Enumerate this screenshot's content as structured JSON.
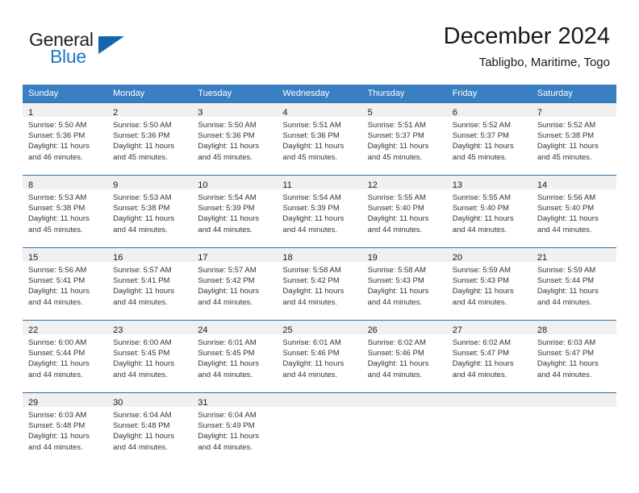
{
  "brand": {
    "word_general": "General",
    "word_blue": "Blue",
    "accent_color": "#1267ae",
    "text_color": "#231f20"
  },
  "header": {
    "title": "December 2024",
    "subtitle": "Tabligbo, Maritime, Togo"
  },
  "theme": {
    "header_row_bg": "#3a7fc1",
    "daynum_band_bg": "#f0f0f0",
    "row_divider": "#2f6fae",
    "body_text": "#333333"
  },
  "weekday_headers": [
    "Sunday",
    "Monday",
    "Tuesday",
    "Wednesday",
    "Thursday",
    "Friday",
    "Saturday"
  ],
  "weeks": [
    [
      {
        "day": "1",
        "sunrise": "Sunrise: 5:50 AM",
        "sunset": "Sunset: 5:36 PM",
        "daylight_1": "Daylight: 11 hours",
        "daylight_2": "and 46 minutes."
      },
      {
        "day": "2",
        "sunrise": "Sunrise: 5:50 AM",
        "sunset": "Sunset: 5:36 PM",
        "daylight_1": "Daylight: 11 hours",
        "daylight_2": "and 45 minutes."
      },
      {
        "day": "3",
        "sunrise": "Sunrise: 5:50 AM",
        "sunset": "Sunset: 5:36 PM",
        "daylight_1": "Daylight: 11 hours",
        "daylight_2": "and 45 minutes."
      },
      {
        "day": "4",
        "sunrise": "Sunrise: 5:51 AM",
        "sunset": "Sunset: 5:36 PM",
        "daylight_1": "Daylight: 11 hours",
        "daylight_2": "and 45 minutes."
      },
      {
        "day": "5",
        "sunrise": "Sunrise: 5:51 AM",
        "sunset": "Sunset: 5:37 PM",
        "daylight_1": "Daylight: 11 hours",
        "daylight_2": "and 45 minutes."
      },
      {
        "day": "6",
        "sunrise": "Sunrise: 5:52 AM",
        "sunset": "Sunset: 5:37 PM",
        "daylight_1": "Daylight: 11 hours",
        "daylight_2": "and 45 minutes."
      },
      {
        "day": "7",
        "sunrise": "Sunrise: 5:52 AM",
        "sunset": "Sunset: 5:38 PM",
        "daylight_1": "Daylight: 11 hours",
        "daylight_2": "and 45 minutes."
      }
    ],
    [
      {
        "day": "8",
        "sunrise": "Sunrise: 5:53 AM",
        "sunset": "Sunset: 5:38 PM",
        "daylight_1": "Daylight: 11 hours",
        "daylight_2": "and 45 minutes."
      },
      {
        "day": "9",
        "sunrise": "Sunrise: 5:53 AM",
        "sunset": "Sunset: 5:38 PM",
        "daylight_1": "Daylight: 11 hours",
        "daylight_2": "and 44 minutes."
      },
      {
        "day": "10",
        "sunrise": "Sunrise: 5:54 AM",
        "sunset": "Sunset: 5:39 PM",
        "daylight_1": "Daylight: 11 hours",
        "daylight_2": "and 44 minutes."
      },
      {
        "day": "11",
        "sunrise": "Sunrise: 5:54 AM",
        "sunset": "Sunset: 5:39 PM",
        "daylight_1": "Daylight: 11 hours",
        "daylight_2": "and 44 minutes."
      },
      {
        "day": "12",
        "sunrise": "Sunrise: 5:55 AM",
        "sunset": "Sunset: 5:40 PM",
        "daylight_1": "Daylight: 11 hours",
        "daylight_2": "and 44 minutes."
      },
      {
        "day": "13",
        "sunrise": "Sunrise: 5:55 AM",
        "sunset": "Sunset: 5:40 PM",
        "daylight_1": "Daylight: 11 hours",
        "daylight_2": "and 44 minutes."
      },
      {
        "day": "14",
        "sunrise": "Sunrise: 5:56 AM",
        "sunset": "Sunset: 5:40 PM",
        "daylight_1": "Daylight: 11 hours",
        "daylight_2": "and 44 minutes."
      }
    ],
    [
      {
        "day": "15",
        "sunrise": "Sunrise: 5:56 AM",
        "sunset": "Sunset: 5:41 PM",
        "daylight_1": "Daylight: 11 hours",
        "daylight_2": "and 44 minutes."
      },
      {
        "day": "16",
        "sunrise": "Sunrise: 5:57 AM",
        "sunset": "Sunset: 5:41 PM",
        "daylight_1": "Daylight: 11 hours",
        "daylight_2": "and 44 minutes."
      },
      {
        "day": "17",
        "sunrise": "Sunrise: 5:57 AM",
        "sunset": "Sunset: 5:42 PM",
        "daylight_1": "Daylight: 11 hours",
        "daylight_2": "and 44 minutes."
      },
      {
        "day": "18",
        "sunrise": "Sunrise: 5:58 AM",
        "sunset": "Sunset: 5:42 PM",
        "daylight_1": "Daylight: 11 hours",
        "daylight_2": "and 44 minutes."
      },
      {
        "day": "19",
        "sunrise": "Sunrise: 5:58 AM",
        "sunset": "Sunset: 5:43 PM",
        "daylight_1": "Daylight: 11 hours",
        "daylight_2": "and 44 minutes."
      },
      {
        "day": "20",
        "sunrise": "Sunrise: 5:59 AM",
        "sunset": "Sunset: 5:43 PM",
        "daylight_1": "Daylight: 11 hours",
        "daylight_2": "and 44 minutes."
      },
      {
        "day": "21",
        "sunrise": "Sunrise: 5:59 AM",
        "sunset": "Sunset: 5:44 PM",
        "daylight_1": "Daylight: 11 hours",
        "daylight_2": "and 44 minutes."
      }
    ],
    [
      {
        "day": "22",
        "sunrise": "Sunrise: 6:00 AM",
        "sunset": "Sunset: 5:44 PM",
        "daylight_1": "Daylight: 11 hours",
        "daylight_2": "and 44 minutes."
      },
      {
        "day": "23",
        "sunrise": "Sunrise: 6:00 AM",
        "sunset": "Sunset: 5:45 PM",
        "daylight_1": "Daylight: 11 hours",
        "daylight_2": "and 44 minutes."
      },
      {
        "day": "24",
        "sunrise": "Sunrise: 6:01 AM",
        "sunset": "Sunset: 5:45 PM",
        "daylight_1": "Daylight: 11 hours",
        "daylight_2": "and 44 minutes."
      },
      {
        "day": "25",
        "sunrise": "Sunrise: 6:01 AM",
        "sunset": "Sunset: 5:46 PM",
        "daylight_1": "Daylight: 11 hours",
        "daylight_2": "and 44 minutes."
      },
      {
        "day": "26",
        "sunrise": "Sunrise: 6:02 AM",
        "sunset": "Sunset: 5:46 PM",
        "daylight_1": "Daylight: 11 hours",
        "daylight_2": "and 44 minutes."
      },
      {
        "day": "27",
        "sunrise": "Sunrise: 6:02 AM",
        "sunset": "Sunset: 5:47 PM",
        "daylight_1": "Daylight: 11 hours",
        "daylight_2": "and 44 minutes."
      },
      {
        "day": "28",
        "sunrise": "Sunrise: 6:03 AM",
        "sunset": "Sunset: 5:47 PM",
        "daylight_1": "Daylight: 11 hours",
        "daylight_2": "and 44 minutes."
      }
    ],
    [
      {
        "day": "29",
        "sunrise": "Sunrise: 6:03 AM",
        "sunset": "Sunset: 5:48 PM",
        "daylight_1": "Daylight: 11 hours",
        "daylight_2": "and 44 minutes."
      },
      {
        "day": "30",
        "sunrise": "Sunrise: 6:04 AM",
        "sunset": "Sunset: 5:48 PM",
        "daylight_1": "Daylight: 11 hours",
        "daylight_2": "and 44 minutes."
      },
      {
        "day": "31",
        "sunrise": "Sunrise: 6:04 AM",
        "sunset": "Sunset: 5:49 PM",
        "daylight_1": "Daylight: 11 hours",
        "daylight_2": "and 44 minutes."
      },
      {
        "day": "",
        "sunrise": "",
        "sunset": "",
        "daylight_1": "",
        "daylight_2": ""
      },
      {
        "day": "",
        "sunrise": "",
        "sunset": "",
        "daylight_1": "",
        "daylight_2": ""
      },
      {
        "day": "",
        "sunrise": "",
        "sunset": "",
        "daylight_1": "",
        "daylight_2": ""
      },
      {
        "day": "",
        "sunrise": "",
        "sunset": "",
        "daylight_1": "",
        "daylight_2": ""
      }
    ]
  ]
}
